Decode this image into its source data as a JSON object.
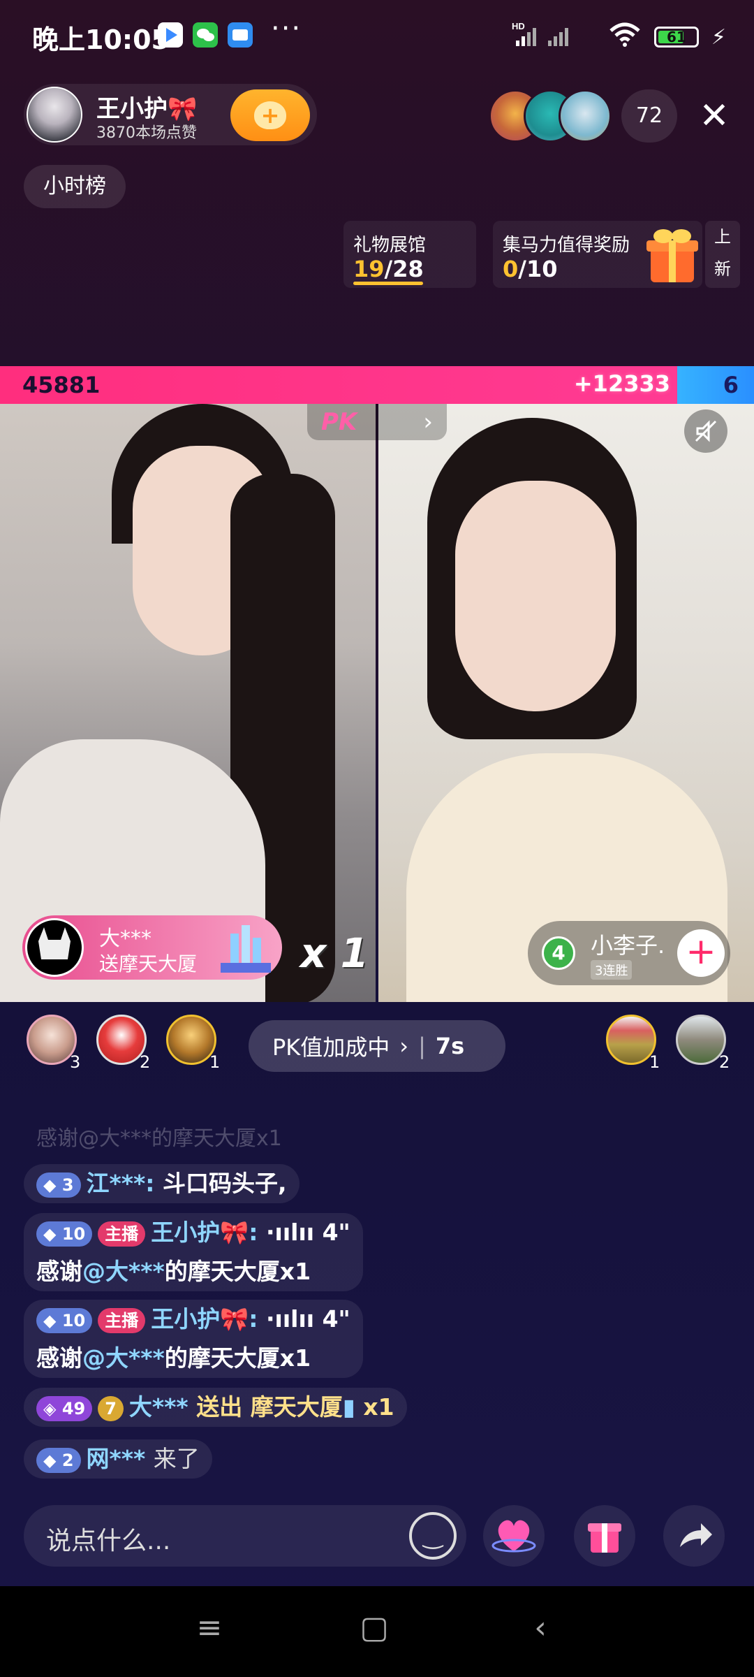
{
  "status_bar": {
    "time": "晚上10:05",
    "dots": "···",
    "battery": "61",
    "signal": "HD"
  },
  "host": {
    "name": "王小护🎀",
    "likes": "3870本场点赞"
  },
  "viewer_count": "72",
  "hour_rank": "小时榜",
  "cards": {
    "gift_hall": {
      "title": "礼物展馆",
      "current": "19",
      "total": "/28"
    },
    "collect": {
      "title": "集马力值得奖励",
      "current": "0",
      "total": "/10"
    },
    "side_tag_1": "上",
    "side_tag_2": "新"
  },
  "pk": {
    "left_score": "45881",
    "bonus": "+12333",
    "right_score": "6",
    "tab_label": "PK",
    "pill_label": "PK值加成中",
    "pill_timer": "7s"
  },
  "gift_banner": {
    "sender": "大***",
    "gift_text": "送摩天大厦",
    "combo": "x 1"
  },
  "opponent": {
    "level": "4",
    "name": "小李子.",
    "streak": "3连胜"
  },
  "contributors_left": [
    {
      "rank": "3"
    },
    {
      "rank": "2"
    },
    {
      "rank": "1"
    }
  ],
  "contributors_right": [
    {
      "rank": "1"
    },
    {
      "rank": "2"
    }
  ],
  "chat": {
    "faded": "感谢@大***的摩天大厦x1",
    "messages": [
      {
        "level": "3",
        "user": "江***:",
        "text": "斗口码头子,"
      },
      {
        "level": "10",
        "role": "主播",
        "user": "王小护🎀:",
        "voice": "·ıılıı 4\"",
        "text_prefix": "感谢",
        "mention": "@大***",
        "text_suffix": "的摩天大厦x1"
      },
      {
        "level": "10",
        "role": "主播",
        "user": "王小护🎀:",
        "voice": "·ıılıı 4\"",
        "text_prefix": "感谢",
        "mention": "@大***",
        "text_suffix": "的摩天大厦x1"
      },
      {
        "fan_level": "49",
        "fan_badge": "7",
        "user": "大***",
        "action": "送出",
        "gift": "摩天大厦",
        "count": "x1"
      },
      {
        "level": "2",
        "user": "网***",
        "text": "来了"
      }
    ]
  },
  "input": {
    "placeholder": "说点什么..."
  },
  "colors": {
    "pk_red": "#ff2e7e",
    "pk_blue": "#36b3ff",
    "accent_gold": "#ffc230"
  }
}
